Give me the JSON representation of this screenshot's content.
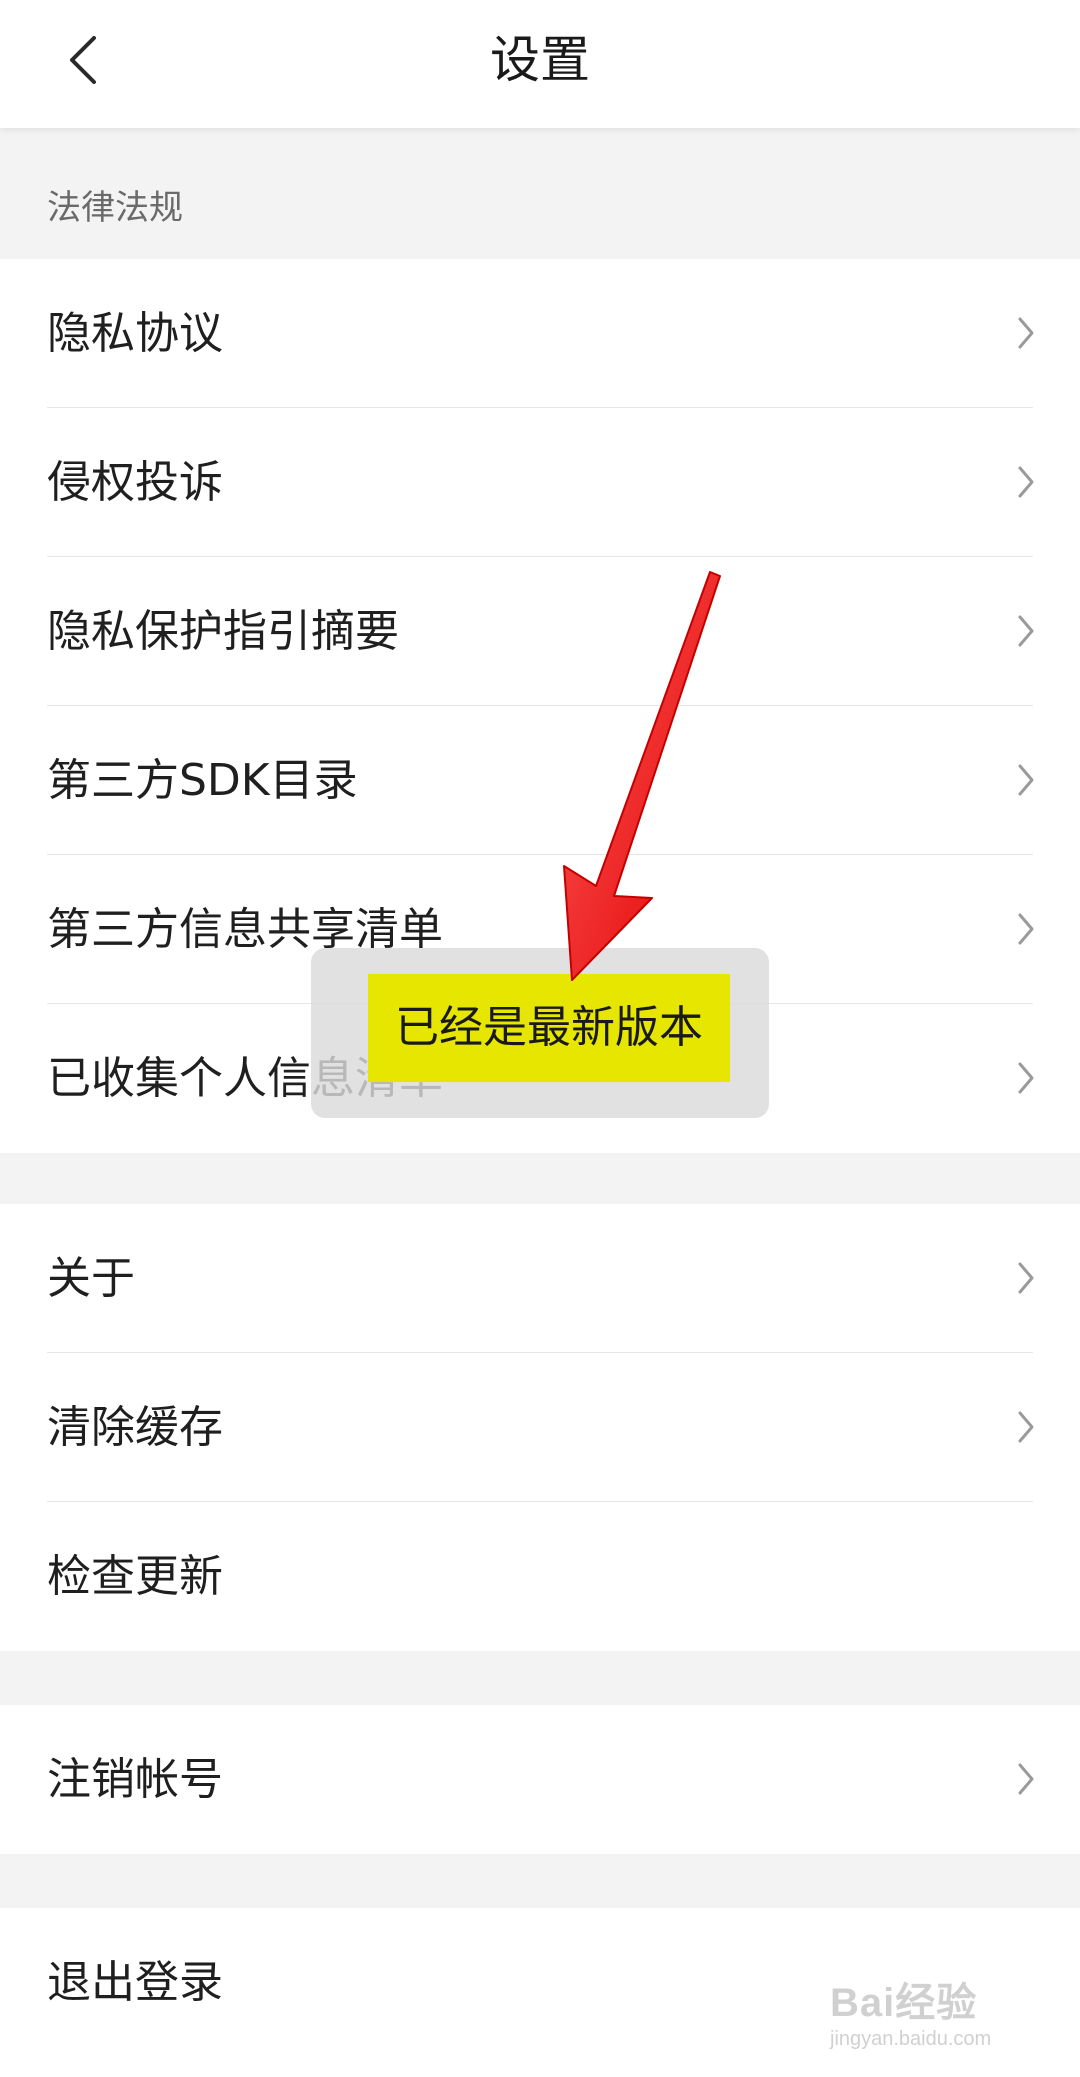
{
  "header": {
    "title": "设置",
    "back_icon": "chevron-left-icon"
  },
  "section_legal": {
    "label": "法律法规",
    "items": [
      {
        "label": "隐私协议"
      },
      {
        "label": "侵权投诉"
      },
      {
        "label": "隐私保护指引摘要"
      },
      {
        "label": "第三方SDK目录"
      },
      {
        "label": "第三方信息共享清单"
      },
      {
        "label": "已收集个人信息清单"
      }
    ]
  },
  "section_general": {
    "items": [
      {
        "label": "关于"
      },
      {
        "label": "清除缓存"
      },
      {
        "label": "检查更新"
      }
    ]
  },
  "section_account": {
    "items": [
      {
        "label": "注销帐号"
      }
    ]
  },
  "section_logout": {
    "items": [
      {
        "label": "退出登录"
      }
    ]
  },
  "toast": {
    "message": "已经是最新版本"
  },
  "annotation": {
    "arrow_color": "#ff1a1a",
    "highlight_color": "#e6e600"
  },
  "watermark": {
    "brand": "Bai经验",
    "url": "jingyan.baidu.com"
  },
  "colors": {
    "background": "#f3f3f3",
    "surface": "#ffffff",
    "divider": "#e6e6e6"
  }
}
